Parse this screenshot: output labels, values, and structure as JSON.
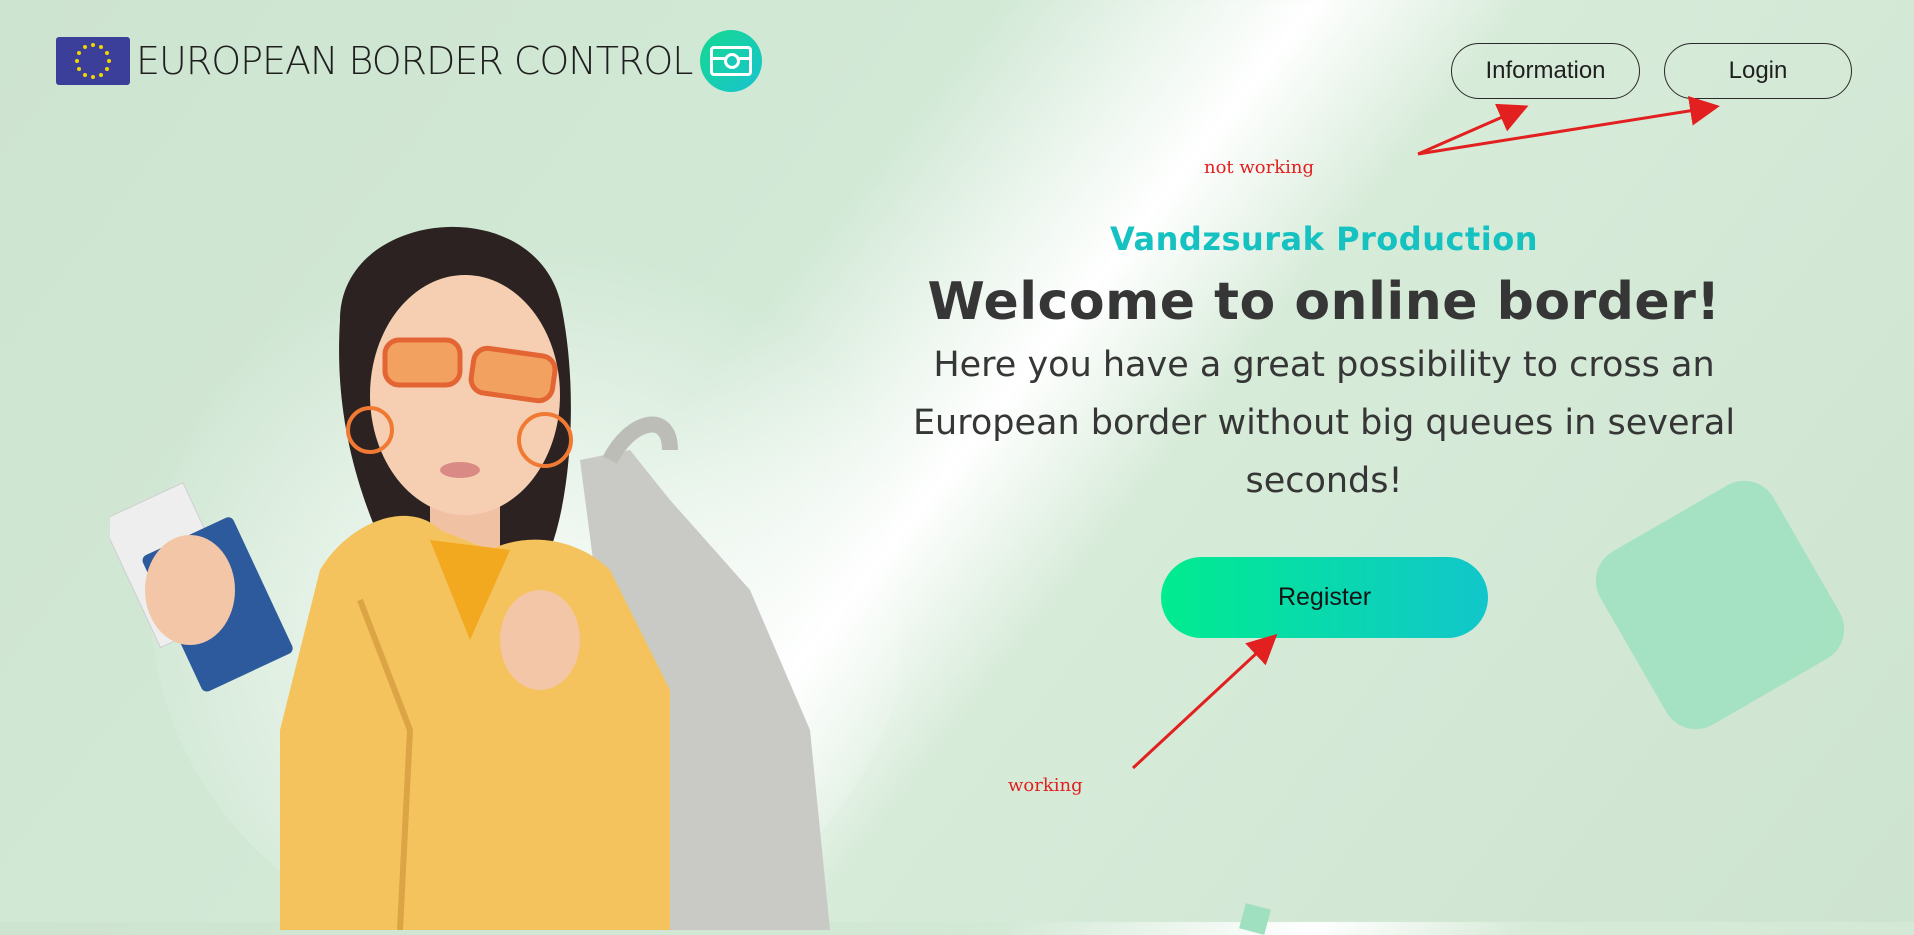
{
  "header": {
    "brand": "EUROPEAN BORDER CONTROL",
    "nav": {
      "information_label": "Information",
      "login_label": "Login"
    }
  },
  "hero": {
    "producer": "Vandzsurak Production",
    "title": "Welcome to online border!",
    "description": "Here you have a great possibility to cross an European border without big queues in several seconds!",
    "register_label": "Register"
  },
  "annotations": {
    "not_working": "not working",
    "working": "working",
    "color": "#e22020"
  },
  "colors": {
    "accent_teal": "#15c2c1",
    "register_gradient_start": "#00ec8f",
    "register_gradient_end": "#12c6cb",
    "text_dark": "#363636",
    "background_green": "#cde4d0"
  },
  "icons": [
    "eu-flag-icon",
    "id-card-icon"
  ]
}
